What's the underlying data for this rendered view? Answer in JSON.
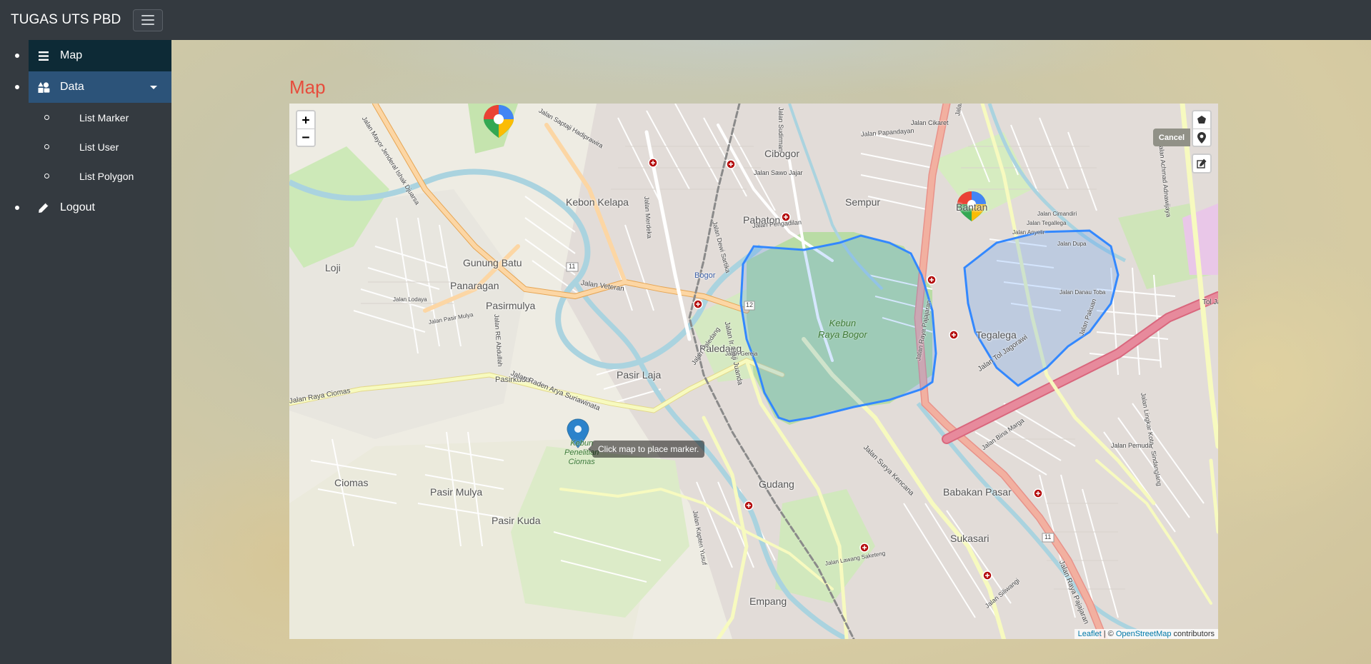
{
  "navbar": {
    "brand": "TUGAS UTS PBD"
  },
  "sidebar": {
    "items": [
      {
        "label": "Map"
      },
      {
        "label": "Data",
        "children": [
          {
            "label": "List Marker"
          },
          {
            "label": "List User"
          },
          {
            "label": "List Polygon"
          }
        ]
      },
      {
        "label": "Logout"
      }
    ]
  },
  "main": {
    "title": "Map"
  },
  "map": {
    "zoom_in": "+",
    "zoom_out": "−",
    "draw_cancel": "Cancel",
    "tooltip": "Click map to place marker.",
    "attribution": {
      "leaflet": "Leaflet",
      "sep": " | © ",
      "osm": "OpenStreetMap",
      "suffix": " contributors"
    },
    "places": {
      "p1": "Kebon Kelapa",
      "p2": "Gunung Batu",
      "p3": "Panaragan",
      "p4": "Pasirmulya",
      "p5": "Loji",
      "p6": "Pabaton",
      "p7": "Cibogor",
      "p8": "Sempur",
      "p9": "Bogor",
      "p10": "Paledang",
      "p11": "Pasir Laja",
      "p12": "Pasirkuda",
      "p13": "Ciomas",
      "p14": "Pasir Mulya",
      "p15": "Pasir Kuda",
      "p16": "Gudang",
      "p17": "Babakan Pasar",
      "p18": "Sukasari",
      "p19": "Empang",
      "p20": "Tegalega",
      "p21": "Bantan"
    },
    "parks": {
      "k1": "Kebun\nRaya Bogor",
      "k2": "Kebun\nPenelitian\nCiomas"
    },
    "streets": {
      "s1": "Jalan Mayor Jenderal Ishak Djuarsa",
      "s2": "Jalan Veteran",
      "s3": "Jalan Merdeka",
      "s4": "Jalan Dewi Sartika",
      "s5": "Jalan Pengadilan",
      "s6": "Jalan Ir. Haji Juanda",
      "s7": "Jalan Raden Arya Suriawinata",
      "s8": "Jalan Raya Ciomas",
      "s9": "Jalan Pajajaran",
      "s10": "Jalan Tol Jagorawi",
      "s11": "Jalan Raya Pajajaran",
      "s12": "Jalan Surya Kencana",
      "s13": "Jalan Sudirman",
      "s14": "Jalan Lingkar Kota - Sindanglang",
      "s15": "Jalan Achmad Adnawijaya",
      "s16": "Jalan Papandayan",
      "s17": "Jalan Pakuan",
      "s18": "Jalan Siliwangi",
      "s19": "Jalan Kapten Yusuf",
      "s20": "Jalan Dupa",
      "s21": "Jalan Danau Toba",
      "s22": "Jalan Cimandiri",
      "s23": "Jalan Tegallega",
      "s24": "Jalan Anyelir",
      "s25": "Jalan Bina Marga",
      "s26": "Jalan Pemuda",
      "s27": "Jalan Saptaji Hadiprawira",
      "s28": "Jalan RE Abdullah",
      "s29": "Jalan Raya Pajajaran",
      "s30": "Jalan Cikaret",
      "s31": "Jalan Sawo Jajar",
      "s32": "Jalan Paledang",
      "s33": "Jalan Gereja",
      "s34": "Jalan Lawang Saketeng",
      "s35": "Jalan Pasir Mulya",
      "s36": "Jalan Lodaya"
    },
    "road_numbers": {
      "r1": "11",
      "r2": "12",
      "r3": "11"
    },
    "tol_label": "Tol Ja"
  }
}
